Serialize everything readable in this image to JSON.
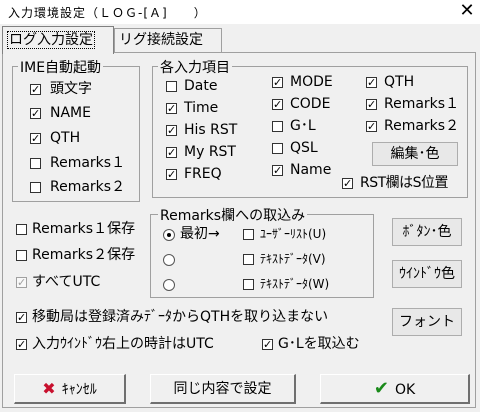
{
  "window": {
    "title": "入力環境設定（ＬＯＧ-[Ａ]　　）",
    "close_glyph": "✕"
  },
  "tabs": [
    {
      "label": "ログ入力設定",
      "active": true
    },
    {
      "label": "リグ接続設定",
      "active": false
    }
  ],
  "ime_group": {
    "title": "IME自動起動",
    "items": [
      {
        "label": "頭文字",
        "checked": true
      },
      {
        "label": "NAME",
        "checked": true
      },
      {
        "label": "QTH",
        "checked": true
      },
      {
        "label": "Remarks１",
        "checked": false
      },
      {
        "label": "Remarks２",
        "checked": false
      }
    ]
  },
  "fields_group": {
    "title": "各入力項目",
    "col1": [
      {
        "label": "Date",
        "checked": false
      },
      {
        "label": "Time",
        "checked": true
      },
      {
        "label": "His RST",
        "checked": true
      },
      {
        "label": "My RST",
        "checked": true
      },
      {
        "label": "FREQ",
        "checked": true
      }
    ],
    "col2": [
      {
        "label": "MODE",
        "checked": true
      },
      {
        "label": "CODE",
        "checked": true
      },
      {
        "label": "G･L",
        "checked": false
      },
      {
        "label": "QSL",
        "checked": false
      },
      {
        "label": "Name",
        "checked": true
      }
    ],
    "col3": [
      {
        "label": "QTH",
        "checked": true
      },
      {
        "label": "Remarks１",
        "checked": true
      },
      {
        "label": "Remarks２",
        "checked": true
      }
    ],
    "edit_button": "編集･色",
    "rst_position": {
      "label": "RST欄はS位置",
      "checked": true
    }
  },
  "save_options": [
    {
      "label": "Remarks１保存",
      "checked": false
    },
    {
      "label": "Remarks２保存",
      "checked": false
    },
    {
      "label": "すべてUTC",
      "checked": true,
      "disabled": true
    }
  ],
  "remarks_group": {
    "title": "Remarks欄への取込み",
    "radios": [
      {
        "label": "最初→",
        "selected": true
      },
      {
        "label": "",
        "selected": false
      },
      {
        "label": "",
        "selected": false
      }
    ],
    "checks": [
      {
        "label": "ﾕｰｻﾞｰﾘｽﾄ(U)",
        "checked": false
      },
      {
        "label": "ﾃｷｽﾄﾃﾞｰﾀ(V)",
        "checked": false
      },
      {
        "label": "ﾃｷｽﾄﾃﾞｰﾀ(W)",
        "checked": false
      }
    ]
  },
  "side_buttons": {
    "button_color": "ﾎﾞﾀﾝ･色",
    "window_color": "ｳｲﾝﾄﾞｳ色",
    "font": "フォント"
  },
  "bottom_options": {
    "mobile_qth": {
      "label": "移動局は登録済みﾃﾞｰﾀからQTHを取り込まない",
      "checked": true
    },
    "clock_utc": {
      "label": "入力ｳｲﾝﾄﾞｳ右上の時計はUTC",
      "checked": true
    },
    "gl_import": {
      "label": "G･Lを取込む",
      "checked": true
    }
  },
  "footer": {
    "cancel": "ｷｬﾝｾﾙ",
    "same_settings": "同じ内容で設定",
    "ok": "OK",
    "cancel_icon": "✖",
    "ok_icon": "✔"
  },
  "colors": {
    "cancel_icon": "#c8102e",
    "ok_icon": "#1a8a1a",
    "panel": "#f0f0f0"
  }
}
